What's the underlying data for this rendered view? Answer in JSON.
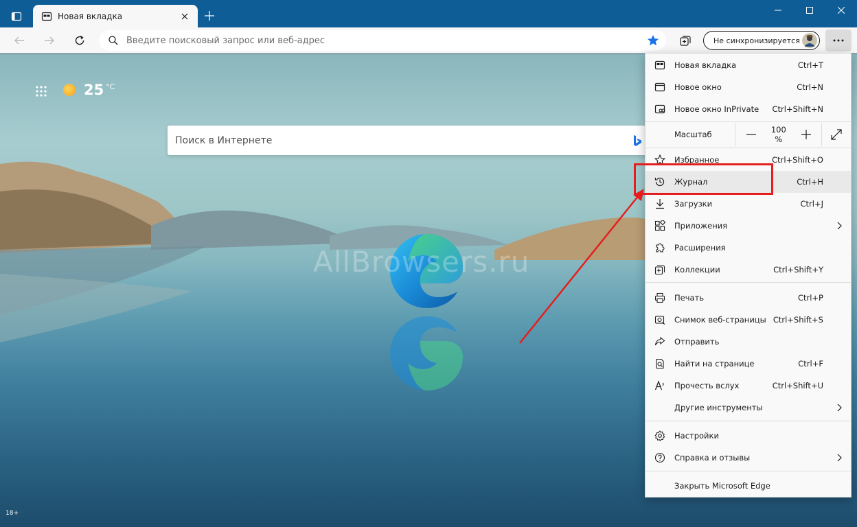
{
  "window": {
    "tab": {
      "title": "Новая вкладка"
    }
  },
  "toolbar": {
    "address_placeholder": "Введите поисковый запрос или веб-адрес",
    "profile_label": "Не синхронизируется"
  },
  "ntp": {
    "weather_temp": "25",
    "weather_unit": "°C",
    "search_placeholder": "Поиск в Интернете",
    "watermark": "AllBrowsers.ru",
    "age_badge": "18+"
  },
  "menu": {
    "items": [
      {
        "label": "Новая вкладка",
        "shortcut": "Ctrl+T",
        "icon": "new-tab-icon"
      },
      {
        "label": "Новое окно",
        "shortcut": "Ctrl+N",
        "icon": "new-window-icon"
      },
      {
        "label": "Новое окно InPrivate",
        "shortcut": "Ctrl+Shift+N",
        "icon": "inprivate-icon"
      },
      {
        "label": "Избранное",
        "shortcut": "Ctrl+Shift+O",
        "icon": "favorites-icon"
      },
      {
        "label": "Журнал",
        "shortcut": "Ctrl+H",
        "icon": "history-icon"
      },
      {
        "label": "Загрузки",
        "shortcut": "Ctrl+J",
        "icon": "downloads-icon"
      },
      {
        "label": "Приложения",
        "shortcut": "",
        "icon": "apps-icon"
      },
      {
        "label": "Расширения",
        "shortcut": "",
        "icon": "extensions-icon"
      },
      {
        "label": "Коллекции",
        "shortcut": "Ctrl+Shift+Y",
        "icon": "collections-icon"
      },
      {
        "label": "Печать",
        "shortcut": "Ctrl+P",
        "icon": "print-icon"
      },
      {
        "label": "Снимок веб-страницы",
        "shortcut": "Ctrl+Shift+S",
        "icon": "web-capture-icon"
      },
      {
        "label": "Отправить",
        "shortcut": "",
        "icon": "share-icon"
      },
      {
        "label": "Найти на странице",
        "shortcut": "Ctrl+F",
        "icon": "find-icon"
      },
      {
        "label": "Прочесть вслух",
        "shortcut": "Ctrl+Shift+U",
        "icon": "read-aloud-icon"
      },
      {
        "label": "Другие инструменты",
        "shortcut": "",
        "icon": ""
      },
      {
        "label": "Настройки",
        "shortcut": "",
        "icon": "settings-icon"
      },
      {
        "label": "Справка и отзывы",
        "shortcut": "",
        "icon": "help-icon"
      },
      {
        "label": "Закрыть Microsoft Edge",
        "shortcut": "",
        "icon": ""
      }
    ],
    "zoom": {
      "label": "Масштаб",
      "value": "100 %"
    }
  },
  "colors": {
    "titlebar": "#0f5d96",
    "accent_blue": "#1a73e8",
    "highlight_red": "#e41e1e"
  }
}
